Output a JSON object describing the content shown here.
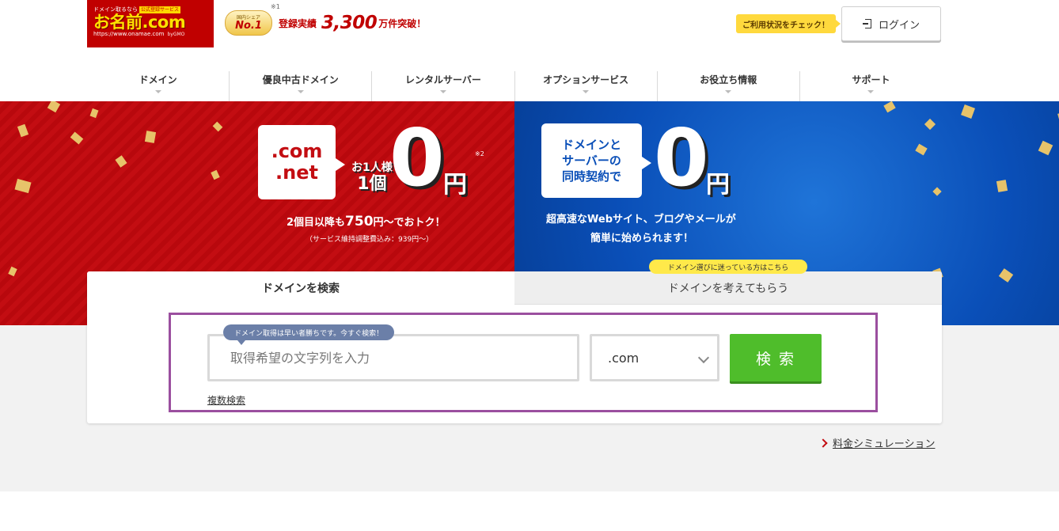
{
  "header": {
    "logo": {
      "tagline": "ドメイン取るなら",
      "badge": "公式登録サービス",
      "brand": "お名前.com",
      "url": "https://www.onamae.com",
      "group": "byGMO"
    },
    "award": {
      "badge_top": "国内シェア",
      "badge_main": "No.1",
      "label": "登録実績",
      "count": "3,300",
      "suffix": "万件突破！",
      "note": "※1"
    },
    "check_label": "ご利用状況をチェック！",
    "login_label": "ログイン"
  },
  "nav": {
    "items": [
      {
        "label": "ドメイン"
      },
      {
        "label": "優良中古ドメイン"
      },
      {
        "label": "レンタルサーバー"
      },
      {
        "label": "オプションサービス"
      },
      {
        "label": "お役立ち情報"
      },
      {
        "label": "サポート"
      }
    ]
  },
  "banner_left": {
    "tld1": ".com",
    "tld2": ".net",
    "per_line1": "お1人様",
    "per_line2": "1個",
    "price": "0",
    "yen": "円",
    "note": "※2",
    "line1_prefix": "2個目以降も",
    "line1_num": "750",
    "line1_suffix": "円〜でおトク！",
    "line2": "（サービス維持調整費込み：939円〜）"
  },
  "banner_right": {
    "box_line1": "ドメインと",
    "box_line2": "サーバーの",
    "box_line3": "同時契約で",
    "price": "0",
    "yen": "円",
    "line1": "超高速なWebサイト、ブログやメールが",
    "line2": "簡単に始められます！"
  },
  "search_panel": {
    "tab_search": "ドメインを検索",
    "tab_suggest": "ドメインを考えてもらう",
    "suggest_badge": "ドメイン選びに迷っている方はこちら",
    "hint": "ドメイン取得は早い者勝ちです。今すぐ検索！",
    "input_placeholder": "取得希望の文字列を入力",
    "input_value": "",
    "tld_selected": ".com",
    "search_button": "検 索",
    "multi_search": "複数検索"
  },
  "footer_links": {
    "simulation": "料金シミュレーション"
  },
  "colors": {
    "brand_red": "#c30d12",
    "brand_blue": "#0a4fb8",
    "search_green": "#4fbd2b",
    "highlight_purple": "#9b4f9f",
    "badge_yellow": "#ffe94a"
  }
}
